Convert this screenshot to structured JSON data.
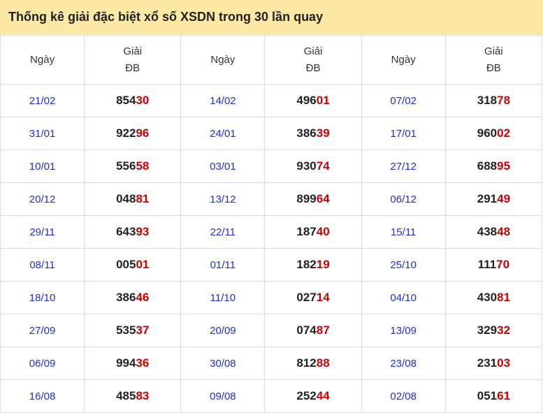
{
  "title": "Thống kê giải đặc biệt xổ số XSDN trong 30 lần quay",
  "headers": {
    "date": "Ngày",
    "prize_line1": "Giải",
    "prize_line2": "ĐB"
  },
  "colors": {
    "title_bg": "#fbe9a5",
    "date_text": "#1e2fd1",
    "tail_digits": "#cc0000"
  },
  "rows": [
    [
      {
        "date": "21/02",
        "head": "854",
        "tail": "30"
      },
      {
        "date": "14/02",
        "head": "496",
        "tail": "01"
      },
      {
        "date": "07/02",
        "head": "318",
        "tail": "78"
      }
    ],
    [
      {
        "date": "31/01",
        "head": "922",
        "tail": "96"
      },
      {
        "date": "24/01",
        "head": "386",
        "tail": "39"
      },
      {
        "date": "17/01",
        "head": "960",
        "tail": "02"
      }
    ],
    [
      {
        "date": "10/01",
        "head": "556",
        "tail": "58"
      },
      {
        "date": "03/01",
        "head": "930",
        "tail": "74"
      },
      {
        "date": "27/12",
        "head": "688",
        "tail": "95"
      }
    ],
    [
      {
        "date": "20/12",
        "head": "048",
        "tail": "81"
      },
      {
        "date": "13/12",
        "head": "899",
        "tail": "64"
      },
      {
        "date": "06/12",
        "head": "291",
        "tail": "49"
      }
    ],
    [
      {
        "date": "29/11",
        "head": "643",
        "tail": "93"
      },
      {
        "date": "22/11",
        "head": "187",
        "tail": "40"
      },
      {
        "date": "15/11",
        "head": "438",
        "tail": "48"
      }
    ],
    [
      {
        "date": "08/11",
        "head": "005",
        "tail": "01"
      },
      {
        "date": "01/11",
        "head": "182",
        "tail": "19"
      },
      {
        "date": "25/10",
        "head": "111",
        "tail": "70"
      }
    ],
    [
      {
        "date": "18/10",
        "head": "386",
        "tail": "46"
      },
      {
        "date": "11/10",
        "head": "027",
        "tail": "14"
      },
      {
        "date": "04/10",
        "head": "430",
        "tail": "81"
      }
    ],
    [
      {
        "date": "27/09",
        "head": "535",
        "tail": "37"
      },
      {
        "date": "20/09",
        "head": "074",
        "tail": "87"
      },
      {
        "date": "13/09",
        "head": "329",
        "tail": "32"
      }
    ],
    [
      {
        "date": "06/09",
        "head": "994",
        "tail": "36"
      },
      {
        "date": "30/08",
        "head": "812",
        "tail": "88"
      },
      {
        "date": "23/08",
        "head": "231",
        "tail": "03"
      }
    ],
    [
      {
        "date": "16/08",
        "head": "485",
        "tail": "83"
      },
      {
        "date": "09/08",
        "head": "252",
        "tail": "44"
      },
      {
        "date": "02/08",
        "head": "051",
        "tail": "61"
      }
    ]
  ]
}
